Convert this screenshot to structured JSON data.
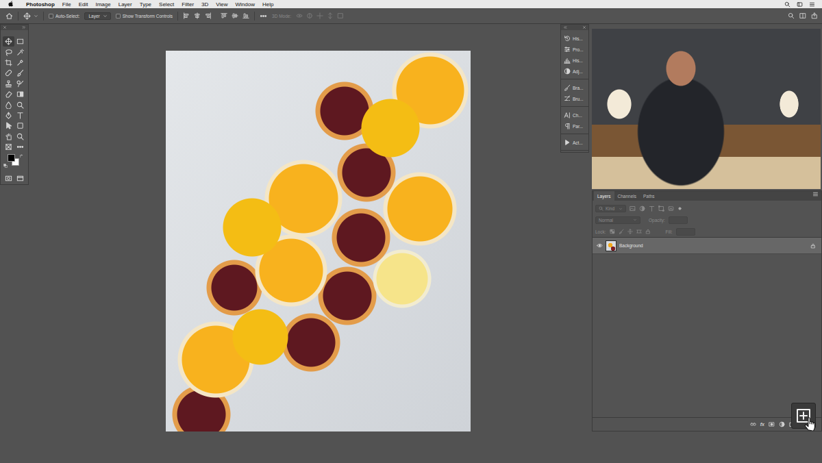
{
  "menu_bar": {
    "app": "Photoshop",
    "items": [
      "File",
      "Edit",
      "Image",
      "Layer",
      "Type",
      "Select",
      "Filter",
      "3D",
      "View",
      "Window",
      "Help"
    ]
  },
  "options_bar": {
    "auto_select": {
      "label": "Auto-Select:",
      "checked": false
    },
    "target": {
      "value": "Layer"
    },
    "transform_controls": {
      "label": "Show Transform Controls",
      "checked": false
    },
    "mode_3d": {
      "label": "3D Mode:",
      "disabled": true
    }
  },
  "toolbar": {
    "tools": [
      {
        "selected": true
      },
      {
        "selected": false
      },
      {
        "selected": false
      },
      {
        "selected": false
      },
      {
        "selected": false
      },
      {
        "selected": false
      },
      {
        "selected": false
      },
      {
        "selected": false
      },
      {
        "selected": false
      },
      {
        "selected": false
      },
      {
        "selected": false
      },
      {
        "selected": false
      },
      {
        "selected": false
      },
      {
        "selected": false
      },
      {
        "selected": false
      },
      {
        "selected": false
      },
      {
        "selected": false
      },
      {
        "selected": false
      },
      {
        "selected": false
      },
      {
        "selected": false
      },
      {
        "selected": false
      },
      {
        "selected": false
      },
      {
        "selected": false
      },
      {
        "selected": false
      }
    ],
    "foreground": "#000000",
    "background": "#ffffff"
  },
  "collapsed_dock": {
    "groups": [
      {
        "items": [
          {
            "label": "His..."
          },
          {
            "label": "Pro..."
          },
          {
            "label": "His..."
          },
          {
            "label": "Adj..."
          }
        ]
      },
      {
        "items": [
          {
            "label": "Bra..."
          },
          {
            "label": "Bru..."
          }
        ]
      },
      {
        "items": [
          {
            "label": "Ch..."
          },
          {
            "label": "Par..."
          }
        ]
      },
      {
        "items": [
          {
            "label": "Act..."
          }
        ]
      }
    ]
  },
  "layers_panel": {
    "tabs": [
      {
        "label": "Layers",
        "selected": true
      },
      {
        "label": "Channels",
        "selected": false
      },
      {
        "label": "Paths",
        "selected": false
      }
    ],
    "filter": {
      "value": "Kind",
      "disabled": true
    },
    "blend_mode": {
      "value": "Normal",
      "disabled": true
    },
    "opacity": {
      "label": "Opacity:",
      "disabled": true
    },
    "lock": {
      "label": "Lock:",
      "disabled": true
    },
    "fill": {
      "label": "Fill:",
      "disabled": true
    },
    "layers": [
      {
        "name": "Background",
        "visible": true,
        "locked": true,
        "selected": true
      }
    ],
    "footer": {
      "fx": "fx"
    }
  }
}
